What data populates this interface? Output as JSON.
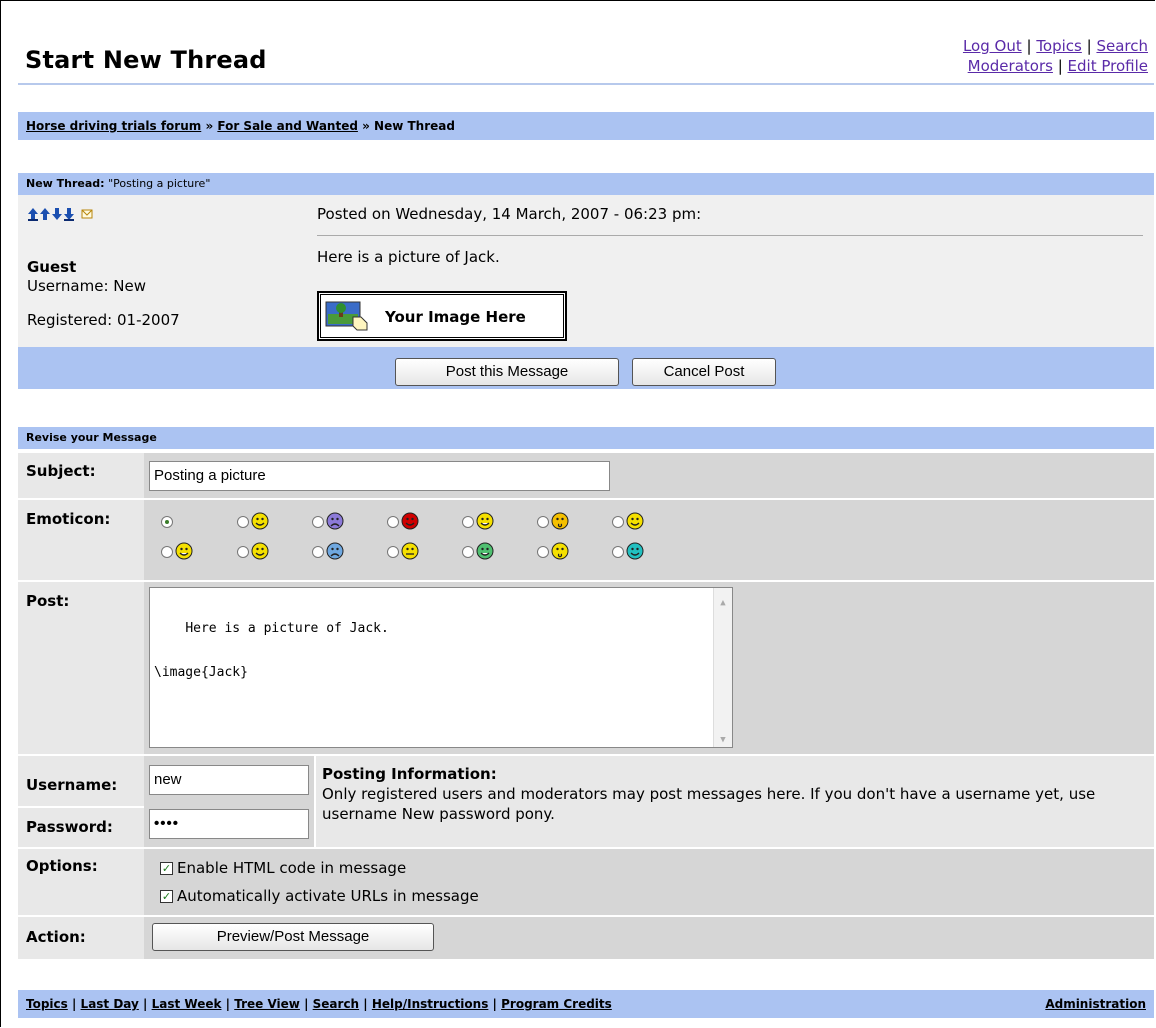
{
  "page": {
    "title": "Start New Thread"
  },
  "top_links": {
    "log_out": "Log Out",
    "topics": "Topics",
    "search": "Search",
    "moderators": "Moderators",
    "edit_profile": "Edit Profile",
    "sep": " | "
  },
  "breadcrumb": {
    "forum": "Horse driving trials forum",
    "sep1": " » ",
    "section": "For Sale and Wanted",
    "sep2": " » ",
    "current": "New Thread"
  },
  "preview": {
    "header_label": "New Thread:",
    "header_subject": " \"Posting a picture\"",
    "posted_on": "Posted on Wednesday, 14 March, 2007 - 06:23 pm:",
    "body": "Here is a picture of Jack.",
    "image_placeholder": "Your Image Here",
    "author": {
      "name": "Guest",
      "username": "Username: New",
      "registered": "Registered: 01-2007"
    }
  },
  "preview_buttons": {
    "post": "Post this Message",
    "cancel": "Cancel Post"
  },
  "revise": {
    "header": "Revise your Message",
    "subject_label": "Subject:",
    "subject_value": "Posting a picture",
    "emoticon_label": "Emoticon:",
    "post_label": "Post:",
    "post_value": "Here is a picture of Jack.\n\n\\image{Jack}",
    "username_label": "Username:",
    "username_value": "new",
    "password_label": "Password:",
    "password_value": "••••",
    "posting_info_title": "Posting Information:",
    "posting_info_text": "Only registered users and moderators may post messages here. If you don't have a username yet, use username New password pony.",
    "options_label": "Options:",
    "option_html": "Enable HTML code in message",
    "option_urls": "Automatically activate URLs in message",
    "action_label": "Action:",
    "action_button": "Preview/Post Message"
  },
  "emoticons": [
    {
      "icon": "none-emoticon",
      "color": "",
      "selected": true
    },
    {
      "icon": "smile-emoticon",
      "color": "#f5e000"
    },
    {
      "icon": "sad-emoticon",
      "color": "#8c7ad8"
    },
    {
      "icon": "angry-emoticon",
      "color": "#d00000"
    },
    {
      "icon": "grin-emoticon",
      "color": "#f5e000"
    },
    {
      "icon": "shocked-emoticon",
      "color": "#f5c000"
    },
    {
      "icon": "happy-emoticon",
      "color": "#f5e000"
    },
    {
      "icon": "laugh-emoticon",
      "color": "#f5e000"
    },
    {
      "icon": "cheerful-emoticon",
      "color": "#f5e000"
    },
    {
      "icon": "crying-emoticon",
      "color": "#6fa8e0"
    },
    {
      "icon": "neutral-emoticon",
      "color": "#f5e000"
    },
    {
      "icon": "teeth-emoticon",
      "color": "#4fc070"
    },
    {
      "icon": "kiss-emoticon",
      "color": "#f5e000"
    },
    {
      "icon": "cool-emoticon",
      "color": "#22c0c0"
    }
  ],
  "footer": {
    "links": [
      "Topics",
      "Last Day",
      "Last Week",
      "Tree View",
      "Search",
      "Help/Instructions",
      "Program Credits"
    ],
    "admin": "Administration"
  }
}
